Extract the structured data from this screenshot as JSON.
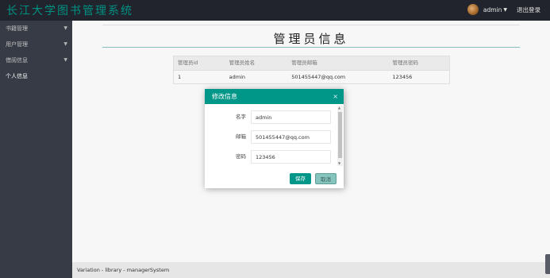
{
  "header": {
    "logo": "长江大学图书管理系统",
    "username": "admin",
    "logout_label": "退出登录"
  },
  "sidebar": {
    "items": [
      {
        "label": "书籍管理",
        "has_arrow": true
      },
      {
        "label": "用户管理",
        "has_arrow": true
      },
      {
        "label": "借阅信息",
        "has_arrow": true
      },
      {
        "label": "个人信息",
        "has_arrow": false
      }
    ]
  },
  "main": {
    "title": "管理员信息",
    "table": {
      "headers": [
        "管理员id",
        "管理员姓名",
        "管理员邮箱",
        "管理员密码"
      ],
      "rows": [
        [
          "1",
          "admin",
          "501455447@qq.com",
          "123456"
        ]
      ]
    }
  },
  "modal": {
    "title": "修改信息",
    "close_symbol": "×",
    "fields": [
      {
        "label": "名字",
        "value": "admin"
      },
      {
        "label": "邮箱",
        "value": "501455447@qq.com"
      },
      {
        "label": "密码",
        "value": "123456"
      }
    ],
    "save_label": "保存",
    "cancel_label": "取消"
  },
  "footer": {
    "text": "Variation - library - managerSystem"
  },
  "colors": {
    "accent": "#009688",
    "header_bg": "#23262e",
    "sidebar_bg": "#393d49"
  }
}
